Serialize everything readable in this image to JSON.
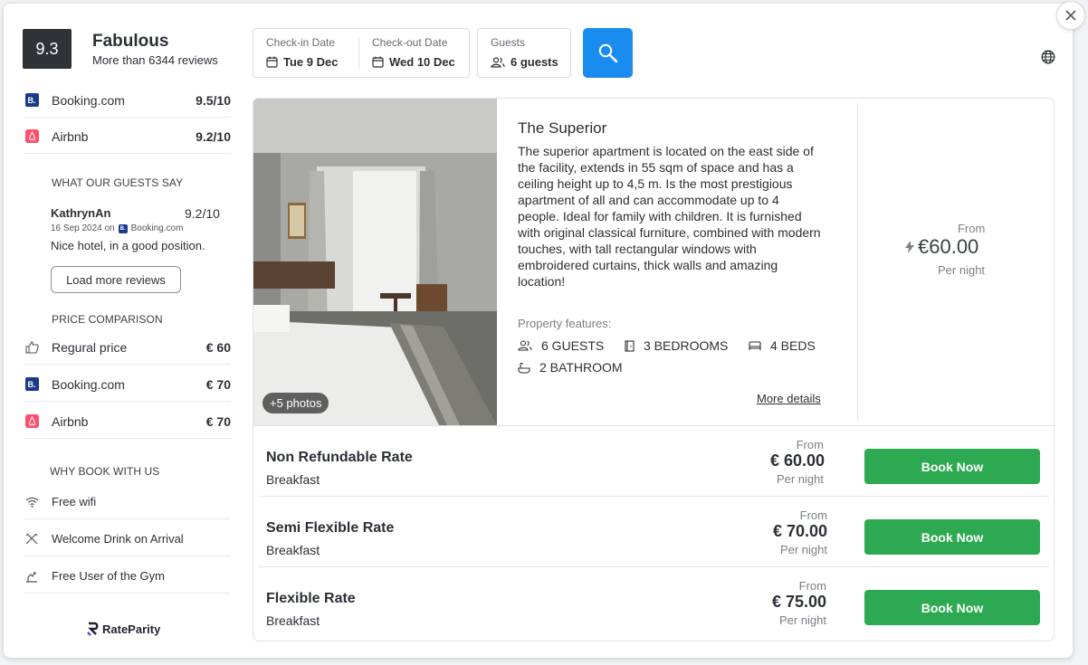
{
  "rating": {
    "score": "9.3",
    "label": "Fabulous",
    "summary": "More than 6344 reviews"
  },
  "sources": [
    {
      "name": "Booking.com",
      "score": "9.5/10",
      "badge": "B."
    },
    {
      "name": "Airbnb",
      "score": "9.2/10"
    }
  ],
  "guests_say": {
    "heading": "WHAT OUR GUESTS SAY",
    "review": {
      "author": "KathrynAn",
      "score": "9.2/10",
      "date": "16 Sep 2024 on",
      "source": "Booking.com",
      "source_badge": "B.",
      "text": "Nice hotel, in a good position."
    },
    "load_more": "Load more reviews"
  },
  "price_comparison": {
    "heading": "PRICE COMPARISON",
    "items": [
      {
        "name": "Regural price",
        "price": "€ 60",
        "icon": "thumbs-up-icon"
      },
      {
        "name": "Booking.com",
        "price": "€ 70",
        "icon": "booking-logo",
        "badge": "B."
      },
      {
        "name": "Airbnb",
        "price": "€ 70",
        "icon": "airbnb-logo"
      }
    ]
  },
  "why_book": {
    "heading": "WHY BOOK WITH US",
    "items": [
      {
        "label": "Free wifi",
        "icon": "wifi-icon"
      },
      {
        "label": "Welcome Drink on Arrival",
        "icon": "utensils-icon"
      },
      {
        "label": "Free User of the Gym",
        "icon": "gym-icon"
      }
    ]
  },
  "brand": {
    "name": "RateParity"
  },
  "search": {
    "checkin_label": "Check-in Date",
    "checkin_value": "Tue 9 Dec",
    "checkout_label": "Check-out Date",
    "checkout_value": "Wed 10 Dec",
    "guests_label": "Guests",
    "guests_value": "6 guests"
  },
  "room": {
    "photos_badge": "+5  photos",
    "title": "The Superior",
    "description": "The superior apartment is located on the east side of the facility, extends in 55 sqm of space and has a ceiling height up to 4,5 m. Is the most prestigious apartment of all and can accommodate up to 4 people. Ideal for family with children. It is furnished with original classical furniture, combined with modern touches, with tall rectangular windows with embroidered curtains, thick walls and amazing location!",
    "features_heading": "Property features:",
    "features": [
      {
        "label": "6 GUESTS",
        "icon": "guests-icon"
      },
      {
        "label": "3 BEDROOMS",
        "icon": "door-icon"
      },
      {
        "label": "4 BEDS",
        "icon": "bed-icon"
      },
      {
        "label": "2 BATHROOM",
        "icon": "bath-icon"
      }
    ],
    "more_details": "More details",
    "from_label": "From",
    "price": "€60.00",
    "per_night": "Per night"
  },
  "rates": [
    {
      "name": "Non Refundable Rate",
      "meal": "Breakfast",
      "from": "From",
      "price": "€ 60.00",
      "per_night": "Per night",
      "button": "Book Now"
    },
    {
      "name": "Semi Flexible Rate",
      "meal": "Breakfast",
      "from": "From",
      "price": "€ 70.00",
      "per_night": "Per night",
      "button": "Book Now"
    },
    {
      "name": "Flexible Rate",
      "meal": "Breakfast",
      "from": "From",
      "price": "€ 75.00",
      "per_night": "Per night",
      "button": "Book Now"
    }
  ],
  "colors": {
    "accent_blue": "#1a8cf0",
    "book_green": "#2daa51",
    "score_dark": "#2f3338",
    "booking_blue": "#1a3a8a",
    "airbnb_red": "#ff4d6a"
  }
}
